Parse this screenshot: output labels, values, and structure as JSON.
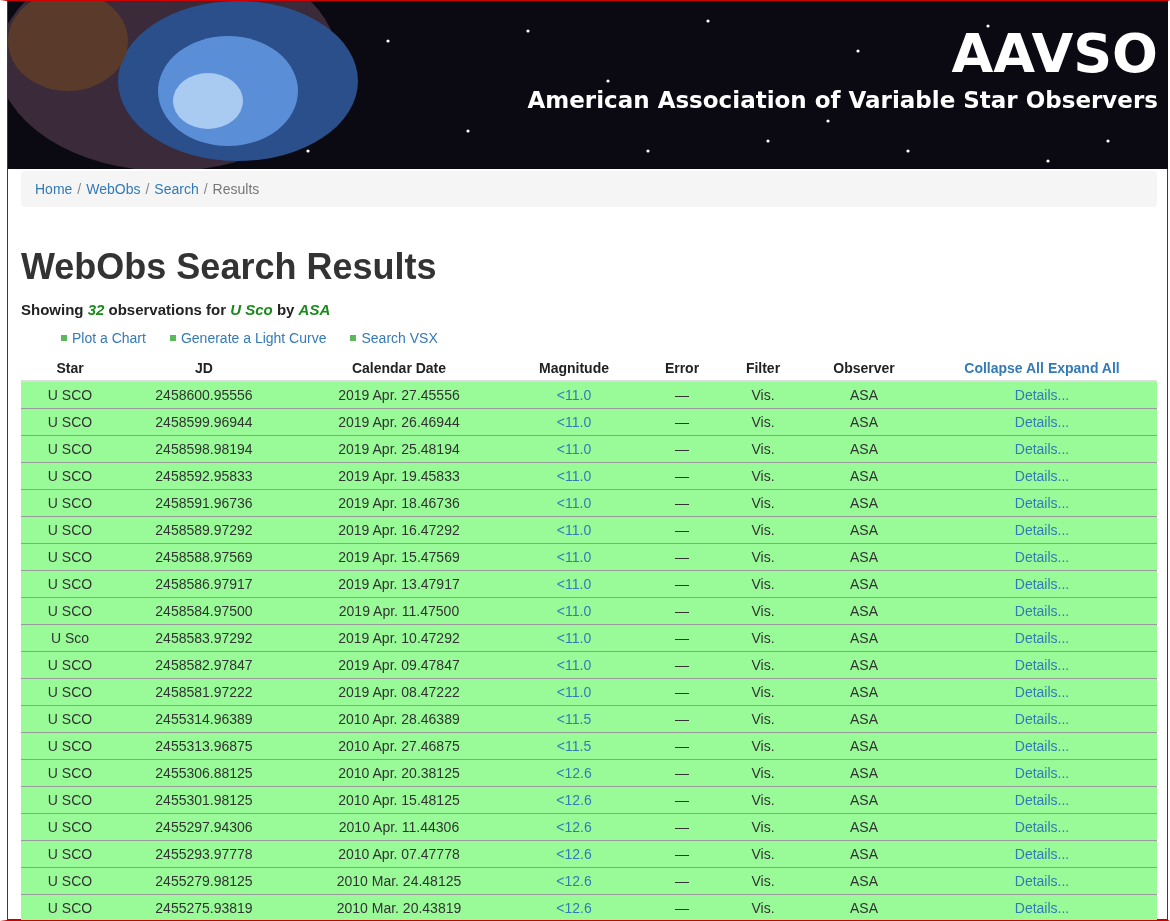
{
  "banner": {
    "title": "AAVSO",
    "subtitle": "American Association of Variable Star Observers"
  },
  "breadcrumb": [
    {
      "label": "Home",
      "link": true,
      "separator": "/"
    },
    {
      "label": "WebObs",
      "link": true,
      "separator": "/"
    },
    {
      "label": "Search",
      "link": true,
      "separator": "/"
    },
    {
      "label": "Results",
      "link": false
    }
  ],
  "heading": "WebObs Search Results",
  "summary": "Showing *32* observations for *U Sco* by *ASA*",
  "actions": [
    "Plot a Chart",
    "Generate a Light Curve",
    "Search VSX"
  ],
  "table": {
    "columns": [
      "Star",
      "JD",
      "Calendar Date",
      "Magnitude",
      "Error",
      "Filter",
      "Observer"
    ],
    "toggles": [
      "Collapse All",
      "Expand All"
    ],
    "rows": [
      {
        "star": "U SCO",
        "jd": "2458600.95556",
        "date": "2019 Apr. 27.45556",
        "magnitude": "<11.0",
        "error": "—",
        "filter": "Vis.",
        "observer": "ASA",
        "details": "Details..."
      },
      {
        "star": "U SCO",
        "jd": "2458599.96944",
        "date": "2019 Apr. 26.46944",
        "magnitude": "<11.0",
        "error": "—",
        "filter": "Vis.",
        "observer": "ASA",
        "details": "Details..."
      },
      {
        "star": "U SCO",
        "jd": "2458598.98194",
        "date": "2019 Apr. 25.48194",
        "magnitude": "<11.0",
        "error": "—",
        "filter": "Vis.",
        "observer": "ASA",
        "details": "Details..."
      },
      {
        "star": "U SCO",
        "jd": "2458592.95833",
        "date": "2019 Apr. 19.45833",
        "magnitude": "<11.0",
        "error": "—",
        "filter": "Vis.",
        "observer": "ASA",
        "details": "Details..."
      },
      {
        "star": "U SCO",
        "jd": "2458591.96736",
        "date": "2019 Apr. 18.46736",
        "magnitude": "<11.0",
        "error": "—",
        "filter": "Vis.",
        "observer": "ASA",
        "details": "Details..."
      },
      {
        "star": "U SCO",
        "jd": "2458589.97292",
        "date": "2019 Apr. 16.47292",
        "magnitude": "<11.0",
        "error": "—",
        "filter": "Vis.",
        "observer": "ASA",
        "details": "Details..."
      },
      {
        "star": "U SCO",
        "jd": "2458588.97569",
        "date": "2019 Apr. 15.47569",
        "magnitude": "<11.0",
        "error": "—",
        "filter": "Vis.",
        "observer": "ASA",
        "details": "Details..."
      },
      {
        "star": "U SCO",
        "jd": "2458586.97917",
        "date": "2019 Apr. 13.47917",
        "magnitude": "<11.0",
        "error": "—",
        "filter": "Vis.",
        "observer": "ASA",
        "details": "Details..."
      },
      {
        "star": "U SCO",
        "jd": "2458584.97500",
        "date": "2019 Apr. 11.47500",
        "magnitude": "<11.0",
        "error": "—",
        "filter": "Vis.",
        "observer": "ASA",
        "details": "Details..."
      },
      {
        "star": "U Sco",
        "jd": "2458583.97292",
        "date": "2019 Apr. 10.47292",
        "magnitude": "<11.0",
        "error": "—",
        "filter": "Vis.",
        "observer": "ASA",
        "details": "Details..."
      },
      {
        "star": "U SCO",
        "jd": "2458582.97847",
        "date": "2019 Apr. 09.47847",
        "magnitude": "<11.0",
        "error": "—",
        "filter": "Vis.",
        "observer": "ASA",
        "details": "Details..."
      },
      {
        "star": "U SCO",
        "jd": "2458581.97222",
        "date": "2019 Apr. 08.47222",
        "magnitude": "<11.0",
        "error": "—",
        "filter": "Vis.",
        "observer": "ASA",
        "details": "Details..."
      },
      {
        "star": "U SCO",
        "jd": "2455314.96389",
        "date": "2010 Apr. 28.46389",
        "magnitude": "<11.5",
        "error": "—",
        "filter": "Vis.",
        "observer": "ASA",
        "details": "Details..."
      },
      {
        "star": "U SCO",
        "jd": "2455313.96875",
        "date": "2010 Apr. 27.46875",
        "magnitude": "<11.5",
        "error": "—",
        "filter": "Vis.",
        "observer": "ASA",
        "details": "Details..."
      },
      {
        "star": "U SCO",
        "jd": "2455306.88125",
        "date": "2010 Apr. 20.38125",
        "magnitude": "<12.6",
        "error": "—",
        "filter": "Vis.",
        "observer": "ASA",
        "details": "Details..."
      },
      {
        "star": "U SCO",
        "jd": "2455301.98125",
        "date": "2010 Apr. 15.48125",
        "magnitude": "<12.6",
        "error": "—",
        "filter": "Vis.",
        "observer": "ASA",
        "details": "Details..."
      },
      {
        "star": "U SCO",
        "jd": "2455297.94306",
        "date": "2010 Apr. 11.44306",
        "magnitude": "<12.6",
        "error": "—",
        "filter": "Vis.",
        "observer": "ASA",
        "details": "Details..."
      },
      {
        "star": "U SCO",
        "jd": "2455293.97778",
        "date": "2010 Apr. 07.47778",
        "magnitude": "<12.6",
        "error": "—",
        "filter": "Vis.",
        "observer": "ASA",
        "details": "Details..."
      },
      {
        "star": "U SCO",
        "jd": "2455279.98125",
        "date": "2010 Mar. 24.48125",
        "magnitude": "<12.6",
        "error": "—",
        "filter": "Vis.",
        "observer": "ASA",
        "details": "Details..."
      },
      {
        "star": "U SCO",
        "jd": "2455275.93819",
        "date": "2010 Mar. 20.43819",
        "magnitude": "<12.6",
        "error": "—",
        "filter": "Vis.",
        "observer": "ASA",
        "details": "Details..."
      }
    ]
  }
}
